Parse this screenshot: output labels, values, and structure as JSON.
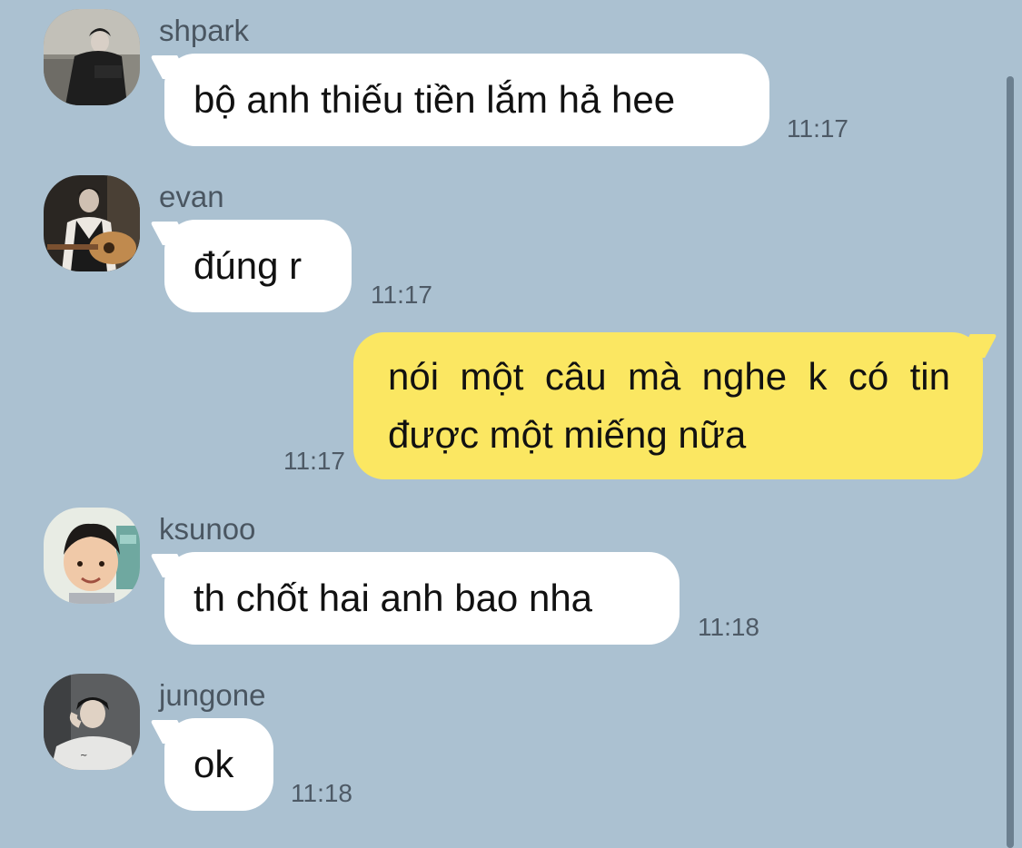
{
  "messages": [
    {
      "sender": "shpark",
      "text": "bộ anh thiếu tiền lắm hả hee",
      "time": "11:17",
      "avatar": "shpark-avatar"
    },
    {
      "sender": "evan",
      "text": "đúng r",
      "time": "11:17",
      "avatar": "evan-avatar"
    },
    {
      "sender": "",
      "text": "nói một câu mà nghe k có tin được một miếng nữa",
      "time": "11:17",
      "outgoing": true
    },
    {
      "sender": "ksunoo",
      "text": "th chốt hai anh bao nha",
      "time": "11:18",
      "avatar": "ksunoo-avatar"
    },
    {
      "sender": "jungone",
      "text": "ok",
      "time": "11:18",
      "avatar": "jungone-avatar"
    }
  ],
  "colors": {
    "background": "#abc1d1",
    "incoming_bubble": "#ffffff",
    "outgoing_bubble": "#fbe762"
  }
}
